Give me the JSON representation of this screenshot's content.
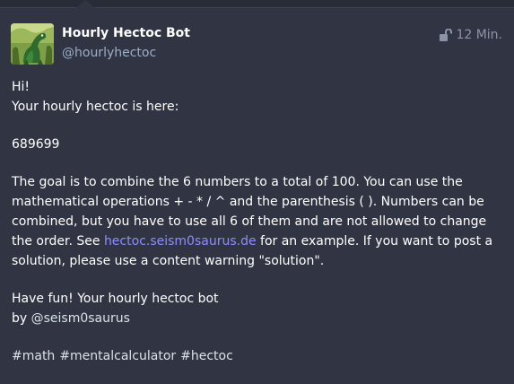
{
  "author": {
    "display_name": "Hourly Hectoc Bot",
    "handle": "@hourlyhectoc"
  },
  "meta": {
    "visibility_icon": "unlock-icon",
    "time": "12 Min."
  },
  "post": {
    "greeting": "Hi!",
    "intro": "Your hourly hectoc is here:",
    "number": "689699",
    "goal_before_link": "The goal is to combine the 6 numbers to a total of 100. You can use the mathematical operations + - * / ^ and the parenthesis ( ). Numbers can be combined, but you have to use all 6 of them and are not allowed to change the order. See ",
    "link_text": "hectoc.seism0saurus.de",
    "goal_after_link": " for an example. If you want to post a solution, please use a content warning \"solution\".",
    "signoff": "Have fun! Your hourly hectoc bot",
    "by_text": "by ",
    "mention": "@seism0saurus",
    "hashtags": [
      "#math",
      "#mentalcalculator",
      "#hectoc"
    ]
  },
  "colors": {
    "background": "#313543",
    "link": "#8c8dff",
    "muted": "#9baec8"
  }
}
